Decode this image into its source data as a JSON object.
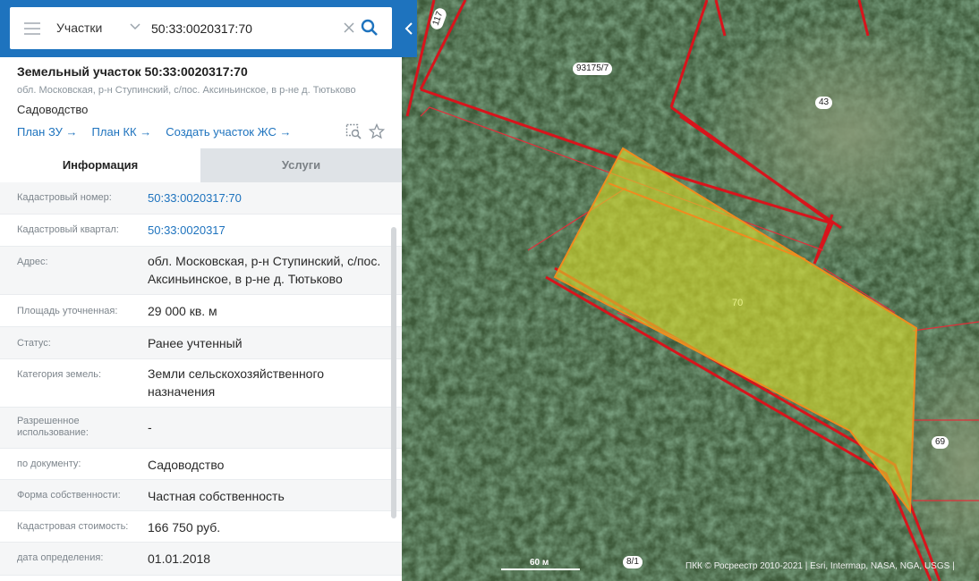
{
  "search": {
    "layer": "Участки",
    "query": "50:33:0020317:70"
  },
  "parcel": {
    "title": "Земельный участок 50:33:0020317:70",
    "address_short": "обл. Московская, р-н Ступинский, с/пос. Аксиньинское, в р-не д. Тютьково",
    "use": "Садоводство",
    "links": [
      "План ЗУ →",
      "План КК →",
      "Создать участок ЖС →"
    ]
  },
  "tabs": {
    "info": "Информация",
    "services": "Услуги"
  },
  "info": {
    "rows": [
      {
        "label": "Кадастровый номер:",
        "value": "50:33:0020317:70",
        "link": true
      },
      {
        "label": "Кадастровый квартал:",
        "value": "50:33:0020317",
        "link": true
      },
      {
        "label": "Адрес:",
        "value": "обл. Московская, р-н Ступинский, с/пос. Аксиньинское, в р-не д. Тютьково"
      },
      {
        "label": "Площадь уточненная:",
        "value": "29 000 кв. м"
      },
      {
        "label": "Статус:",
        "value": "Ранее учтенный"
      },
      {
        "label": "Категория земель:",
        "value": "Земли сельскохозяйственного назначения"
      },
      {
        "label": "Разрешенное использование:",
        "value": "-"
      },
      {
        "label": "по документу:",
        "value": "Садоводство"
      },
      {
        "label": "Форма собственности:",
        "value": "Частная собственность"
      },
      {
        "label": "Кадастровая стоимость:",
        "value": "166 750 руб."
      },
      {
        "label": "дата определения:",
        "value": "01.01.2018"
      }
    ]
  },
  "map": {
    "labels": [
      "117",
      "93175/7",
      "43",
      "70",
      "69",
      "8/1"
    ],
    "scale": "60 м",
    "attribution": "ПКК © Росреестр 2010-2021 | Esri, Intermap, NASA, NGA, USGS |",
    "colors": {
      "boundary": "#d8141c",
      "selected_fill": "#d8dc2a",
      "selected_stroke": "#f08c1e"
    }
  }
}
